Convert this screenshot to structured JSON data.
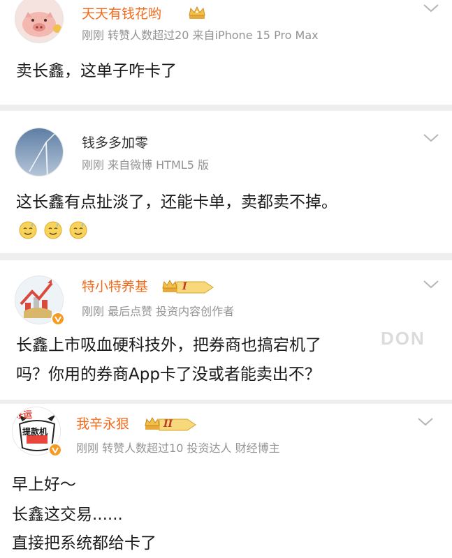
{
  "posts": [
    {
      "username": "天天有钱花哟",
      "meta": "刚刚  转赞人数超过20  来自iPhone 15 Pro Max",
      "text": [
        "卖长鑫，这单子咋卡了"
      ]
    },
    {
      "username": "钱多多加零",
      "meta": "刚刚  来自微博 HTML5 版",
      "text": [
        "这长鑫有点扯淡了，还能卡单，卖都卖不掉。"
      ]
    },
    {
      "username": "特小特养基",
      "meta": "刚刚  最后点赞  投资内容创作者",
      "text": [
        "长鑫上市吸血硬科技外，把券商也搞宕机了",
        "吗？你用的券商App卡了没或者能卖出不？"
      ]
    },
    {
      "username": "我辛永狠",
      "meta": "刚刚  转赞人数超过10  投资达人  财经博主",
      "text": [
        "早上好～",
        "长鑫这交易......",
        "直接把系统都给卡了"
      ]
    }
  ],
  "badges": {
    "level_1": "I",
    "level_2": "II"
  },
  "avatar_labels": {
    "post4_top": "好运",
    "post4_main": "提款机"
  },
  "watermark": "DON",
  "colors": {
    "username_vip": "#f26b1d",
    "meta": "#939393",
    "text": "#1a1a1a",
    "separator": "#eeeeee"
  },
  "icons": [
    "crown-icon",
    "chevron-down-icon",
    "verified-v-icon",
    "sweat-smile-emoji"
  ]
}
